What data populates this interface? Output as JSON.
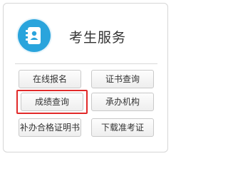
{
  "panel": {
    "title": "考生服务",
    "icon": "contact-book-icon"
  },
  "buttons": [
    {
      "label": "在线报名"
    },
    {
      "label": "证书查询"
    },
    {
      "label": "成绩查询",
      "highlighted": true
    },
    {
      "label": "承办机构"
    },
    {
      "label": "补办合格证明书"
    },
    {
      "label": "下载准考证"
    }
  ],
  "colors": {
    "icon_bg": "#2aa4dc",
    "highlight_border": "#e12a2a"
  }
}
